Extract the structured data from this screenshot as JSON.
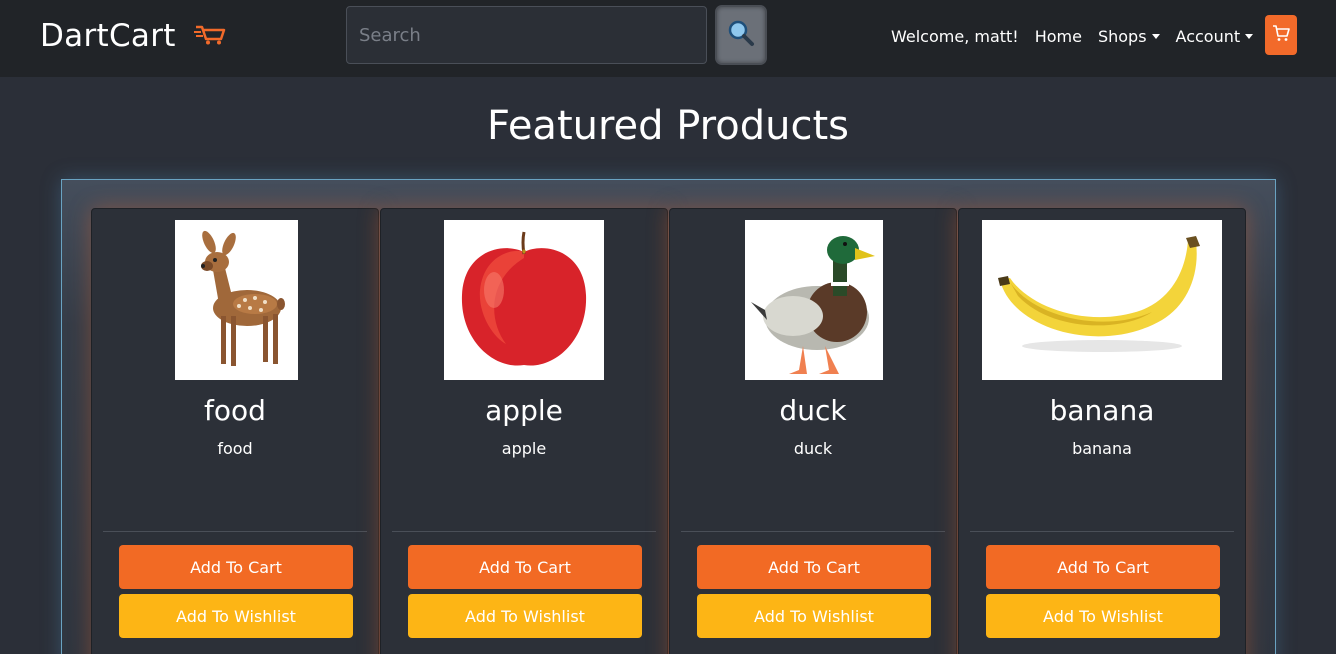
{
  "navbar": {
    "brand": "DartCart",
    "search_placeholder": "Search",
    "welcome": "Welcome, matt!",
    "home": "Home",
    "shops": "Shops",
    "account": "Account"
  },
  "page": {
    "title": "Featured Products"
  },
  "products": [
    {
      "name": "food",
      "description": "food",
      "add_to_cart": "Add To Cart",
      "add_to_wishlist": "Add To Wishlist"
    },
    {
      "name": "apple",
      "description": "apple",
      "add_to_cart": "Add To Cart",
      "add_to_wishlist": "Add To Wishlist"
    },
    {
      "name": "duck",
      "description": "duck",
      "add_to_cart": "Add To Cart",
      "add_to_wishlist": "Add To Wishlist"
    },
    {
      "name": "banana",
      "description": "banana",
      "add_to_cart": "Add To Cart",
      "add_to_wishlist": "Add To Wishlist"
    }
  ],
  "colors": {
    "accent_orange": "#f26a24",
    "wishlist_yellow": "#fdb515",
    "navbar_bg": "#212428",
    "page_bg": "#2b2f38"
  }
}
